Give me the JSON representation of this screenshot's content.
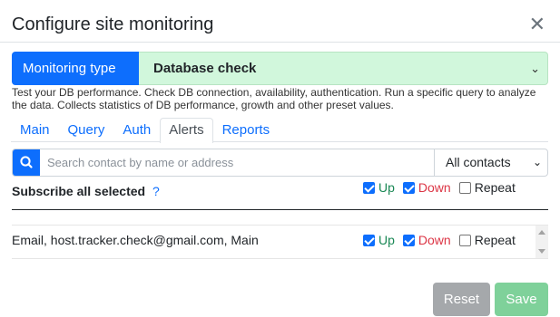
{
  "dialog": {
    "title": "Configure site monitoring",
    "close_icon": "close-icon"
  },
  "monitoring_type": {
    "label": "Monitoring type",
    "value": "Database check"
  },
  "description": "Test your DB performance. Check DB connection, availability, authentication. Run a specific query to analyze the data. Collects statistics of DB performance, growth and other preset values.",
  "tabs": [
    {
      "label": "Main",
      "active": false
    },
    {
      "label": "Query",
      "active": false
    },
    {
      "label": "Auth",
      "active": false
    },
    {
      "label": "Alerts",
      "active": true
    },
    {
      "label": "Reports",
      "active": false
    }
  ],
  "search": {
    "placeholder": "Search contact by name or address",
    "filter_value": "All contacts",
    "icon": "search-icon"
  },
  "subscribe": {
    "label": "Subscribe all selected",
    "help": "?",
    "up": {
      "label": "Up",
      "checked": true
    },
    "down": {
      "label": "Down",
      "checked": true
    },
    "repeat": {
      "label": "Repeat",
      "checked": false
    }
  },
  "contacts": [
    {
      "text": "Email, host.tracker.check@gmail.com, Main",
      "up": {
        "label": "Up",
        "checked": true
      },
      "down": {
        "label": "Down",
        "checked": true
      },
      "repeat": {
        "label": "Repeat",
        "checked": false
      }
    }
  ],
  "buttons": {
    "reset": "Reset",
    "save": "Save"
  },
  "colors": {
    "primary": "#0d6efd",
    "up": "#198754",
    "down": "#dc3545",
    "select_bg": "#d1f7dc",
    "reset_bg": "#a5a8ab",
    "save_bg": "#7fd19a"
  }
}
